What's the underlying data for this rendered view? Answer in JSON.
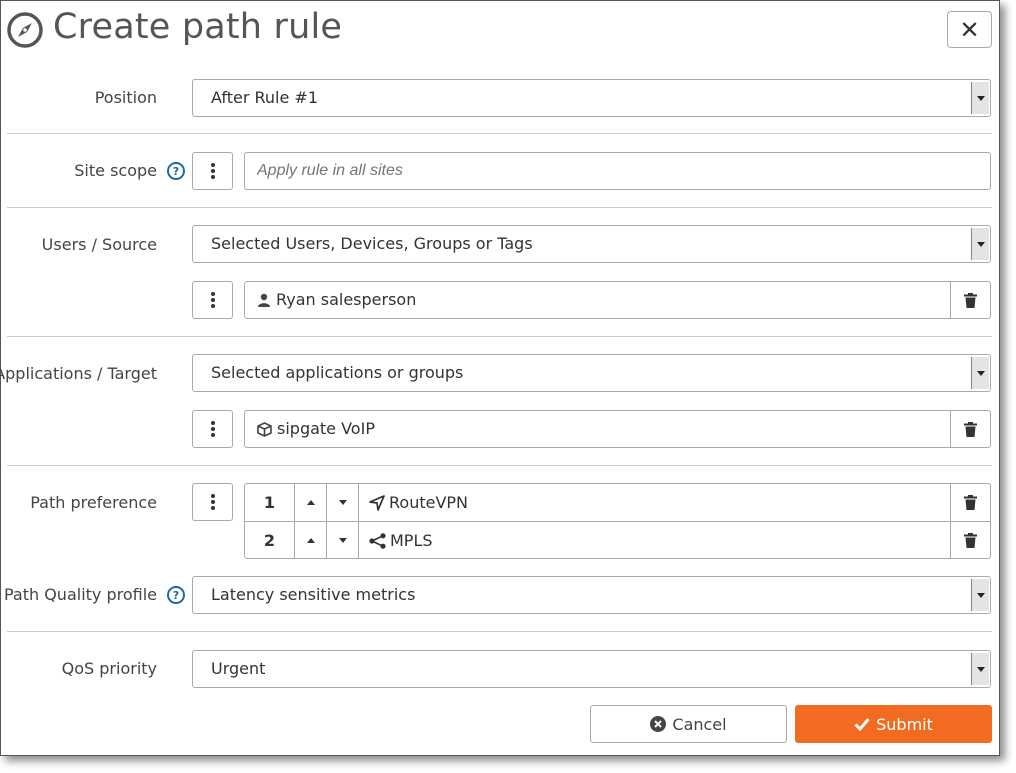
{
  "dialog": {
    "title": "Create path rule",
    "close_label": "✕"
  },
  "position": {
    "label": "Position",
    "value": "After Rule #1"
  },
  "site_scope": {
    "label": "Site scope",
    "placeholder": "Apply rule in all sites"
  },
  "users_source": {
    "label": "Users / Source",
    "value": "Selected Users, Devices, Groups or Tags",
    "items": [
      "Ryan salesperson"
    ]
  },
  "applications_target": {
    "label": "Applications / Target",
    "value": "Selected applications or groups",
    "items": [
      "sipgate VoIP"
    ]
  },
  "path_preference": {
    "label": "Path preference",
    "paths": [
      {
        "order": "1",
        "name": "RouteVPN",
        "icon": "location-arrow-icon"
      },
      {
        "order": "2",
        "name": "MPLS",
        "icon": "share-icon"
      }
    ]
  },
  "path_quality": {
    "label": "Path Quality profile",
    "value": "Latency sensitive metrics"
  },
  "qos_priority": {
    "label": "QoS priority",
    "value": "Urgent"
  },
  "actions": {
    "cancel_label": "Cancel",
    "submit_label": "Submit"
  },
  "colors": {
    "accent": "#f26b21",
    "help": "#1a6aa8"
  }
}
